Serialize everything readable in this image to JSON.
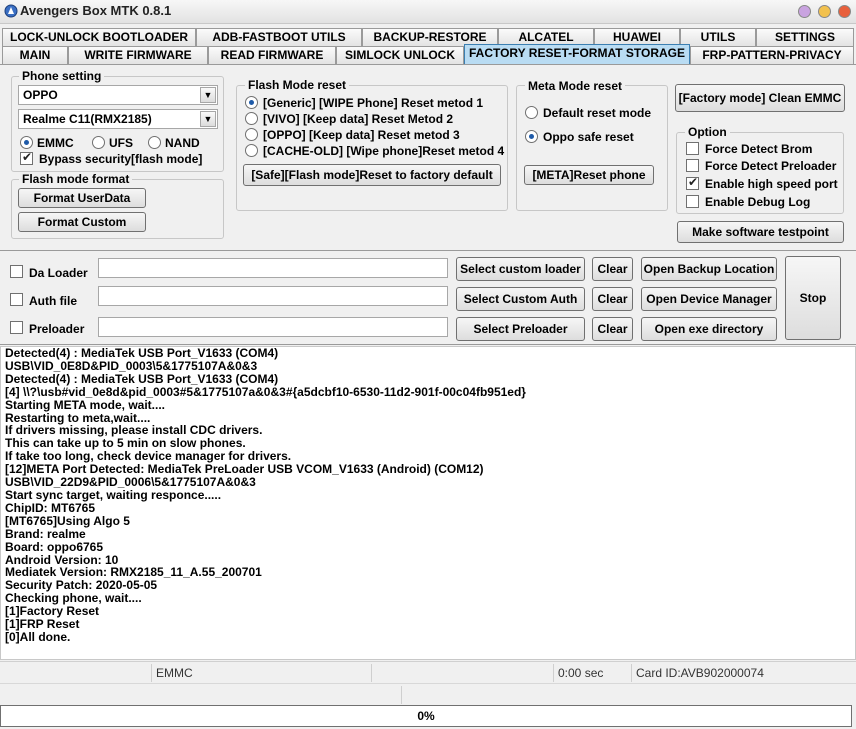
{
  "window": {
    "title": "Avengers Box MTK 0.8.1"
  },
  "tabs_top": [
    {
      "label": "LOCK-UNLOCK BOOTLOADER"
    },
    {
      "label": "ADB-FASTBOOT UTILS"
    },
    {
      "label": "BACKUP-RESTORE"
    },
    {
      "label": "ALCATEL"
    },
    {
      "label": "HUAWEI"
    },
    {
      "label": "UTILS"
    },
    {
      "label": "SETTINGS"
    }
  ],
  "tabs_bottom": [
    {
      "label": "MAIN"
    },
    {
      "label": "WRITE FIRMWARE"
    },
    {
      "label": "READ FIRMWARE"
    },
    {
      "label": "SIMLOCK UNLOCK"
    },
    {
      "label": "FACTORY RESET-FORMAT STORAGE"
    },
    {
      "label": "FRP-PATTERN-PRIVACY"
    }
  ],
  "phone_setting": {
    "title": "Phone setting",
    "brand": "OPPO",
    "model": "Realme C11(RMX2185)",
    "storage": [
      {
        "label": "EMMC",
        "selected": true
      },
      {
        "label": "UFS",
        "selected": false
      },
      {
        "label": "NAND",
        "selected": false
      }
    ],
    "bypass_label": "Bypass security[flash mode]"
  },
  "flash_format": {
    "title": "Flash mode format",
    "format_userdata": "Format UserData",
    "format_custom": "Format Custom"
  },
  "flash_reset": {
    "title": "Flash Mode reset",
    "options": [
      {
        "label": "[Generic] [WIPE Phone] Reset metod 1"
      },
      {
        "label": "[VIVO] [Keep data] Reset Metod 2"
      },
      {
        "label": "[OPPO] [Keep data] Reset metod 3"
      },
      {
        "label": "[CACHE-OLD] [Wipe phone]Reset metod 4"
      }
    ],
    "safe_button": "[Safe][Flash mode]Reset to factory default"
  },
  "meta_reset": {
    "title": "Meta Mode reset",
    "options": [
      {
        "label": "Default reset mode"
      },
      {
        "label": "Oppo safe reset"
      }
    ],
    "meta_button": "[META]Reset phone"
  },
  "factory_clean": "[Factory mode] Clean EMMC",
  "option": {
    "title": "Option",
    "items": [
      {
        "label": "Force Detect Brom",
        "checked": false
      },
      {
        "label": "Force Detect Preloader",
        "checked": false
      },
      {
        "label": "Enable high speed port",
        "checked": true
      },
      {
        "label": "Enable Debug Log",
        "checked": false
      }
    ]
  },
  "testpoint_button": "Make software testpoint",
  "loaders": {
    "da_label": "Da Loader",
    "auth_label": "Auth file",
    "pre_label": "Preloader",
    "select_loader": "Select custom loader",
    "select_auth": "Select Custom Auth",
    "select_pre": "Select Preloader",
    "clear": "Clear",
    "open_backup": "Open Backup Location",
    "open_device": "Open Device Manager",
    "open_exe": "Open exe directory",
    "stop": "Stop"
  },
  "log": [
    "Detected(4) : MediaTek USB Port_V1633 (COM4)",
    "USB\\VID_0E8D&PID_0003\\5&1775107A&0&3",
    "Detected(4) : MediaTek USB Port_V1633 (COM4)",
    "[4] \\\\?\\usb#vid_0e8d&pid_0003#5&1775107a&0&3#{a5dcbf10-6530-11d2-901f-00c04fb951ed}",
    "Starting META mode, wait....",
    "Restarting to meta,wait....",
    "If drivers missing, please install CDC drivers.",
    "This can take up to 5 min on slow phones.",
    "If take too long, check device manager for drivers.",
    "[12]META Port Detected: MediaTek PreLoader USB VCOM_V1633 (Android) (COM12)",
    "USB\\VID_22D9&PID_0006\\5&1775107A&0&3",
    "Start sync target, waiting responce.....",
    "ChipID: MT6765",
    "[MT6765]Using Algo 5",
    "Brand: realme",
    "Board: oppo6765",
    "Android Version: 10",
    "Mediatek Version: RMX2185_11_A.55_200701",
    "Security Patch: 2020-05-05",
    "Checking phone, wait....",
    "[1]Factory Reset",
    "[1]FRP Reset",
    "[0]All done."
  ],
  "status": {
    "storage": "EMMC",
    "time": "0:00 sec",
    "card": "Card ID:AVB902000074"
  },
  "progress": {
    "value": 0,
    "label": "0%"
  },
  "colors": {
    "active_tab": "#b9dcf3",
    "radio_dot": "#1e5aa8"
  }
}
